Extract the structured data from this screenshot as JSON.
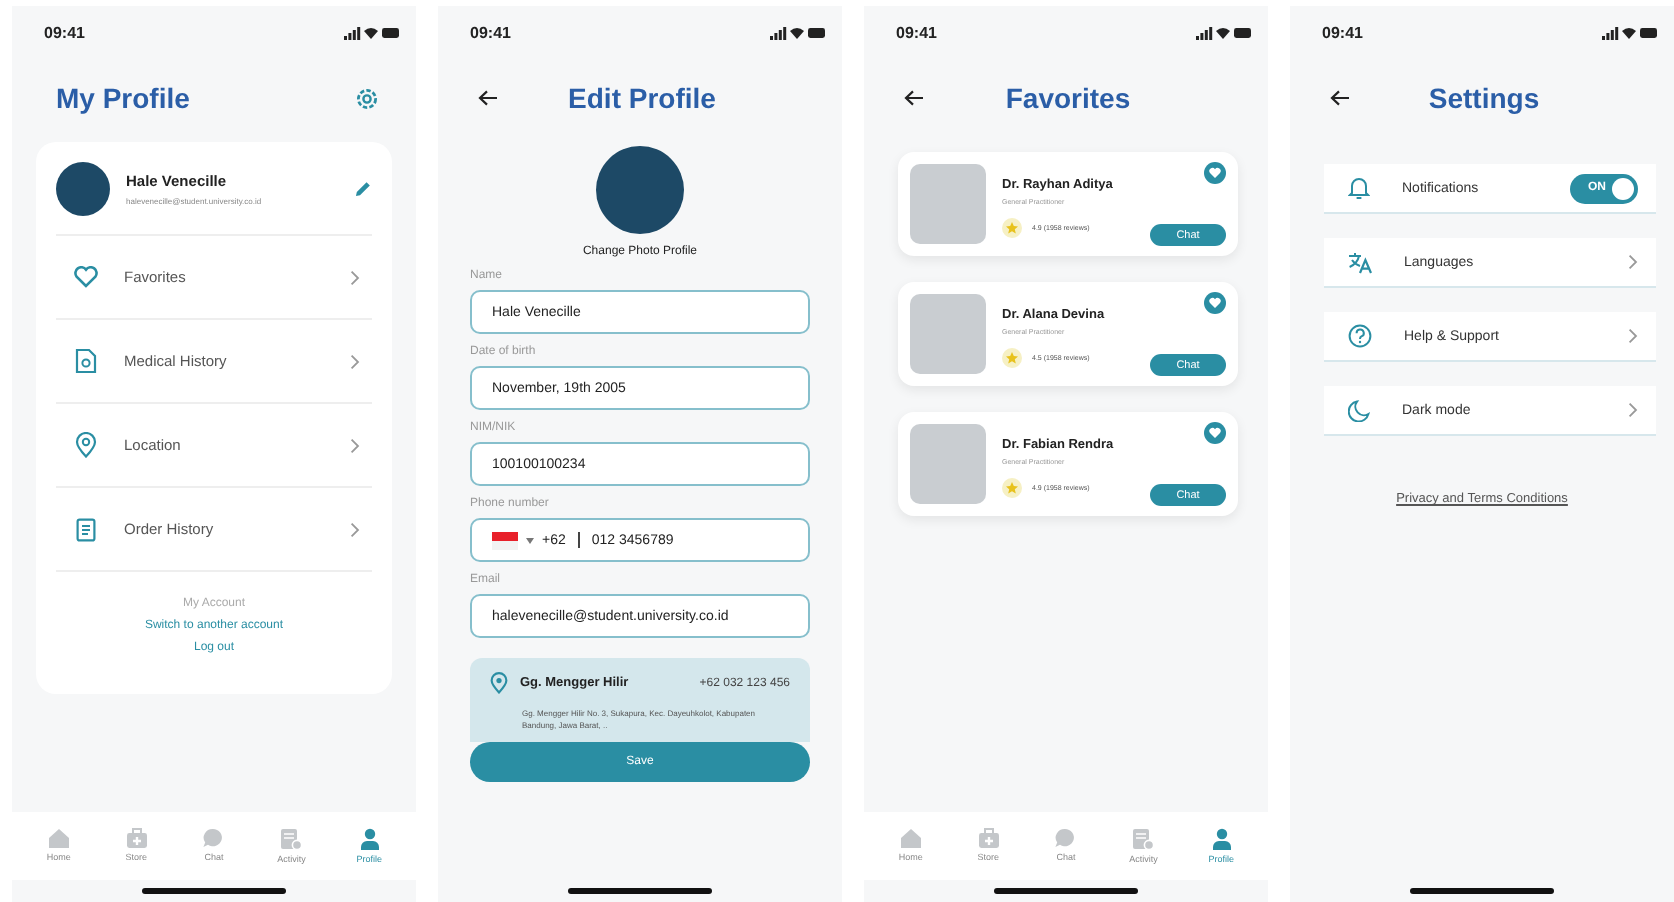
{
  "profile_screen": {
    "status_time": "09:41",
    "title": "My Profile",
    "user": {
      "name": "Hale Venecille",
      "email": "halevenecille@student.university.co.id"
    },
    "menu": [
      {
        "label": "Favorites"
      },
      {
        "label": "Medical History"
      },
      {
        "label": "Location"
      },
      {
        "label": "Order History"
      }
    ],
    "account_heading": "My Account",
    "account_links": [
      "Switch to another account",
      "Log out"
    ],
    "nav": [
      {
        "label": "Home",
        "selected": false
      },
      {
        "label": "Store",
        "selected": false
      },
      {
        "label": "Chat",
        "selected": false
      },
      {
        "label": "Activity",
        "selected": false
      },
      {
        "label": "Profile",
        "selected": true
      }
    ]
  },
  "edit_profile_screen": {
    "status_time": "09:41",
    "title": "Edit Profile",
    "photo_caption": "Change Photo Profile",
    "fields": [
      {
        "label": "Name",
        "value": "Hale Venecille"
      },
      {
        "label": "Date of birth",
        "value": "November, 19th 2005"
      },
      {
        "label": "NIM/NIK",
        "value": "100100100234"
      },
      {
        "label": "Phone number",
        "kind": "phone",
        "code": "+62",
        "value": "012 3456789"
      },
      {
        "label": "Email",
        "value": "halevenecille@student.university.co.id"
      }
    ],
    "address": {
      "name": "Gg. Mengger Hilir",
      "phone": "+62 032 123 456",
      "detail": "Gg. Mengger Hilir No. 3, Sukapura, Kec. Dayeuhkolot, Kabupaten Bandung, Jawa Barat, .."
    },
    "save_button": "Save"
  },
  "favorites_screen": {
    "status_time": "09:41",
    "title": "Favorites",
    "doctors": [
      {
        "name": "Dr. Rayhan Aditya",
        "specialty": "General Practitioner",
        "rating": "4.9 (1958 reviews)",
        "action": "Chat"
      },
      {
        "name": "Dr. Alana Devina",
        "specialty": "General Practitioner",
        "rating": "4.5 (1958 reviews)",
        "action": "Chat"
      },
      {
        "name": "Dr. Fabian Rendra",
        "specialty": "General Practitioner",
        "rating": "4.9 (1958 reviews)",
        "action": "Chat"
      }
    ],
    "nav": [
      {
        "label": "Home",
        "selected": false
      },
      {
        "label": "Store",
        "selected": false
      },
      {
        "label": "Chat",
        "selected": false
      },
      {
        "label": "Activity",
        "selected": false
      },
      {
        "label": "Profile",
        "selected": true
      }
    ]
  },
  "settings_screen": {
    "status_time": "09:41",
    "title": "Settings",
    "items": [
      {
        "label": "Notifications",
        "kind": "toggle",
        "on": true,
        "toggle_label": "ON"
      },
      {
        "label": "Languages",
        "kind": "link"
      },
      {
        "label": "Help & Support",
        "kind": "link"
      },
      {
        "label": "Dark mode",
        "kind": "link"
      }
    ],
    "footer_link": "Privacy and Terms Conditions"
  }
}
